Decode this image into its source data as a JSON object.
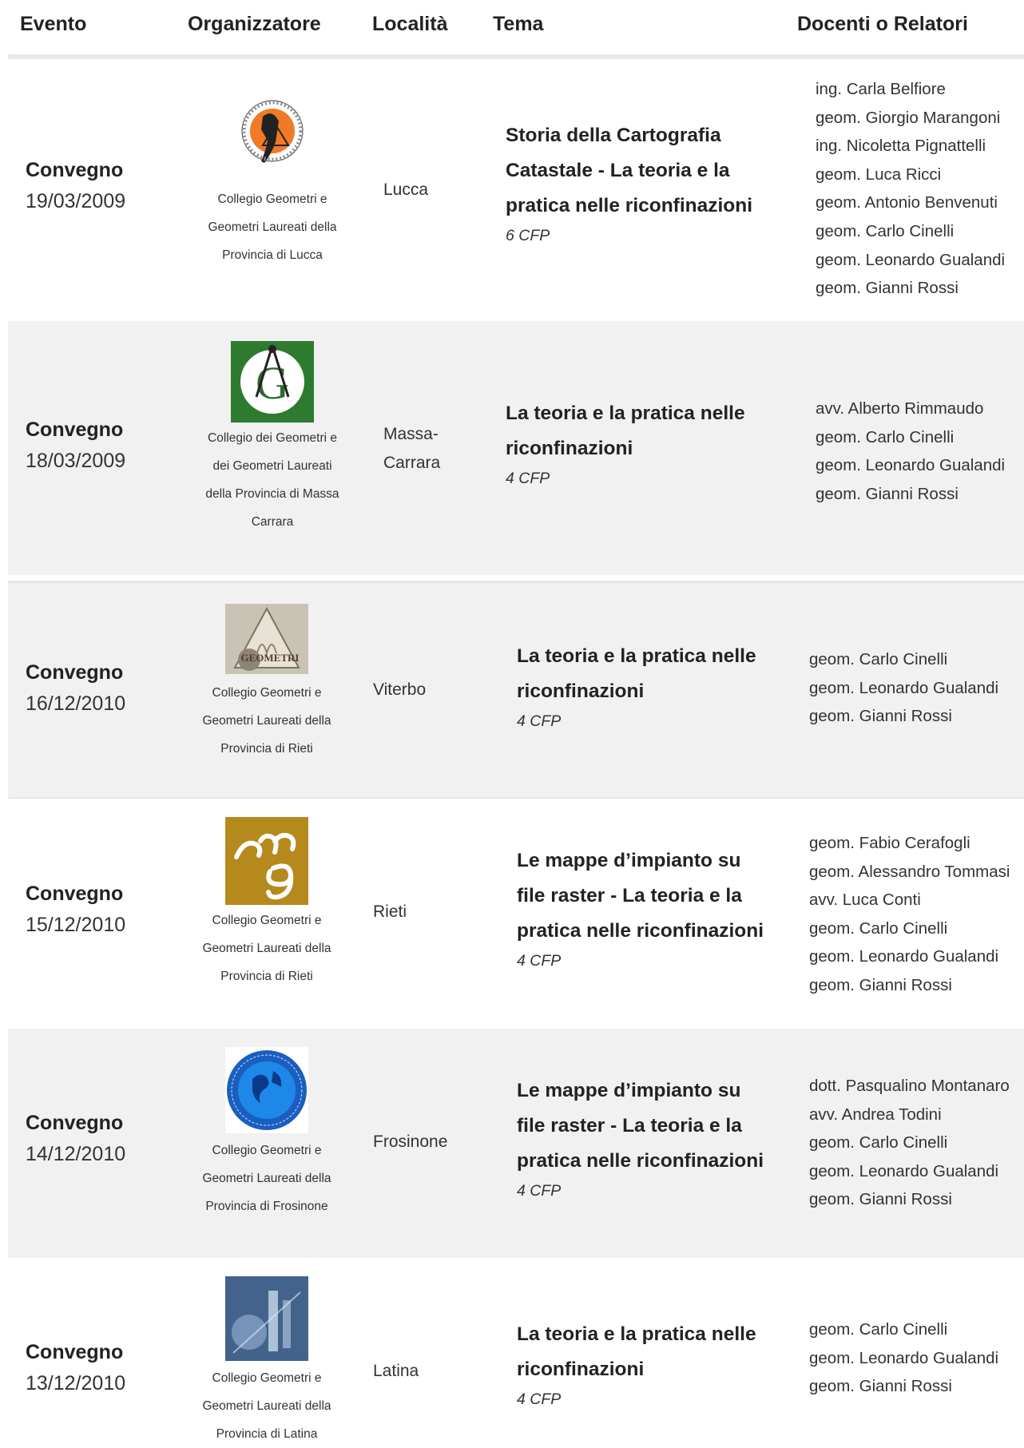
{
  "header": {
    "evento": "Evento",
    "organizzatore": "Organizzatore",
    "localita": "Località",
    "tema": "Tema",
    "docenti": "Docenti o Relatori"
  },
  "rows": [
    {
      "type": "Convegno",
      "date": "19/03/2009",
      "organizer": "Collegio Geometri e Geometri Laureati della Provincia di Lucca",
      "organizer_lines": [
        "Collegio Geometri e",
        "Geometri Laureati della",
        "Provincia di Lucca"
      ],
      "logo": "collegio-geometri-lucca-logo",
      "location_lines": [
        "Lucca"
      ],
      "theme_lines": [
        "Storia della Cartografia",
        "Catastale - La teoria e la",
        "pratica nelle riconfinazioni"
      ],
      "cfp": "6 CFP",
      "speakers": [
        "ing. Carla Belfiore",
        "geom. Giorgio Marangoni",
        "ing. Nicoletta Pignattelli",
        "geom. Luca Ricci",
        "geom. Antonio Benvenuti",
        "geom. Carlo Cinelli",
        "geom. Leonardo Gualandi",
        "geom. Gianni Rossi"
      ]
    },
    {
      "type": "Convegno",
      "date": "18/03/2009",
      "organizer": "Collegio dei Geometri e dei Geometri Laureati della Provincia di Massa Carrara",
      "organizer_lines": [
        "Collegio dei Geometri e",
        "dei Geometri Laureati",
        "della Provincia di Massa",
        "Carrara"
      ],
      "logo": "collegio-geometri-massa-carrara-logo",
      "location_lines": [
        "Massa-",
        "Carrara"
      ],
      "theme_lines": [
        "La teoria e la pratica nelle",
        "riconfinazioni"
      ],
      "cfp": "4 CFP",
      "speakers": [
        "avv. Alberto Rimmaudo",
        "geom. Carlo Cinelli",
        "geom. Leonardo Gualandi",
        "geom. Gianni Rossi"
      ]
    },
    {
      "type": "Convegno",
      "date": "16/12/2010",
      "organizer": "Collegio Geometri e Geometri Laureati della Provincia di Rieti",
      "organizer_lines": [
        "Collegio Geometri e",
        "Geometri Laureati della",
        "Provincia di Rieti"
      ],
      "logo": "geometri-viterbo-logo",
      "location_lines": [
        "Viterbo"
      ],
      "theme_lines": [
        "La teoria e la pratica nelle",
        "riconfinazioni"
      ],
      "cfp": "4 CFP",
      "speakers": [
        "geom. Carlo Cinelli",
        "geom. Leonardo Gualandi",
        "geom. Gianni Rossi"
      ]
    },
    {
      "type": "Convegno",
      "date": "15/12/2010",
      "organizer": "Collegio Geometri e Geometri Laureati della Provincia di Rieti",
      "organizer_lines": [
        "Collegio Geometri e",
        "Geometri Laureati della",
        "Provincia di Rieti"
      ],
      "logo": "collegio-geometri-rieti-logo",
      "location_lines": [
        "Rieti"
      ],
      "theme_lines": [
        "Le mappe d’impianto su",
        "file raster - La teoria e la",
        "pratica nelle riconfinazioni"
      ],
      "cfp": "4 CFP",
      "speakers": [
        "geom. Fabio Cerafogli",
        "geom. Alessandro Tommasi",
        "avv. Luca Conti",
        "geom. Carlo Cinelli",
        "geom. Leonardo Gualandi",
        "geom. Gianni Rossi"
      ]
    },
    {
      "type": "Convegno",
      "date": "14/12/2010",
      "organizer": "Collegio Geometri e Geometri Laureati della Provincia di Frosinone",
      "organizer_lines": [
        "Collegio Geometri e",
        "Geometri Laureati della",
        "Provincia di Frosinone"
      ],
      "logo": "collegio-geometri-frosinone-logo",
      "location_lines": [
        "Frosinone"
      ],
      "theme_lines": [
        "Le mappe d’impianto su",
        "file raster - La teoria e la",
        "pratica nelle riconfinazioni"
      ],
      "cfp": "4 CFP",
      "speakers": [
        "dott. Pasqualino Montanaro",
        "avv. Andrea Todini",
        "geom. Carlo Cinelli",
        "geom. Leonardo Gualandi",
        "geom. Gianni Rossi"
      ]
    },
    {
      "type": "Convegno",
      "date": "13/12/2010",
      "organizer": "Collegio Geometri e Geometri Laureati della Provincia di Latina",
      "organizer_lines": [
        "Collegio Geometri e",
        "Geometri Laureati della",
        "Provincia di Latina"
      ],
      "logo": "collegio-geometri-latina-logo",
      "location_lines": [
        "Latina"
      ],
      "theme_lines": [
        "La teoria e la pratica nelle",
        "riconfinazioni"
      ],
      "cfp": "4 CFP",
      "speakers": [
        "geom. Carlo Cinelli",
        "geom. Leonardo Gualandi",
        "geom. Gianni Rossi"
      ]
    }
  ]
}
